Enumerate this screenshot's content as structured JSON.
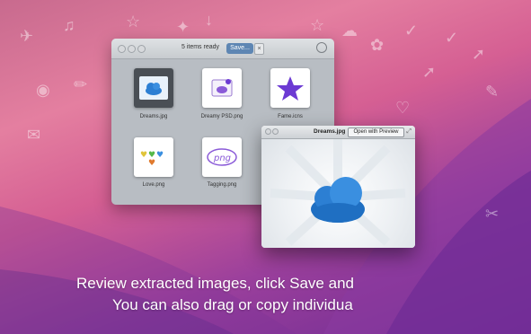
{
  "main_window": {
    "status_text": "5 items ready",
    "save_label": "Save...",
    "cancel_label": "×",
    "items": [
      {
        "name": "Dreams.jpg"
      },
      {
        "name": "Dreamy PSD.png"
      },
      {
        "name": "Fame.icns"
      },
      {
        "name": "Love.png"
      },
      {
        "name": "Tagging.png"
      }
    ]
  },
  "preview_window": {
    "title": "Dreams.jpg",
    "open_label": "Open with Preview"
  },
  "captions": {
    "line1": "Review extracted images, click Save and",
    "line2": "You can also drag or copy individua"
  },
  "colors": {
    "accent_blue": "#5e86b3",
    "cloud_blue": "#2c7fd3",
    "star_purple": "#6c3ad3"
  }
}
